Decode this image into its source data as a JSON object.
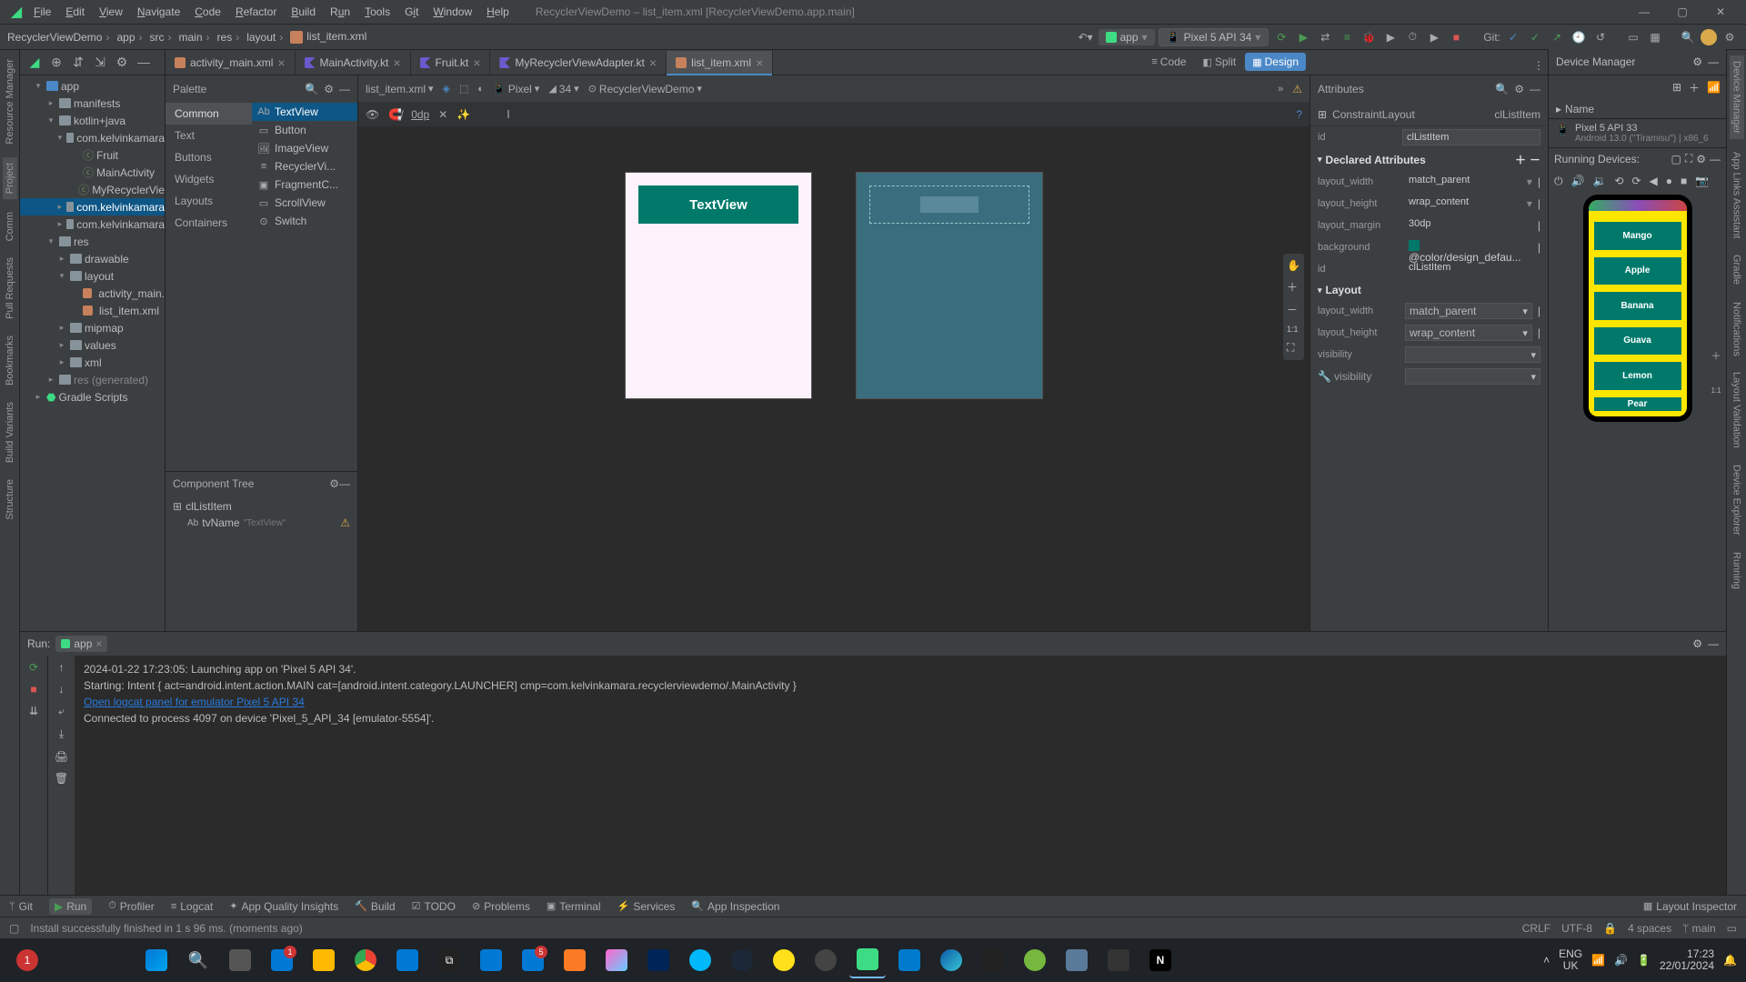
{
  "window": {
    "title": "RecyclerViewDemo – list_item.xml [RecyclerViewDemo.app.main]",
    "menus": [
      "File",
      "Edit",
      "View",
      "Navigate",
      "Code",
      "Refactor",
      "Build",
      "Run",
      "Tools",
      "Git",
      "Window",
      "Help"
    ]
  },
  "breadcrumb": [
    "RecyclerViewDemo",
    "app",
    "src",
    "main",
    "res",
    "layout"
  ],
  "breadcrumb_file": "list_item.xml",
  "run_config": {
    "label": "app"
  },
  "device_select": "Pixel 5 API 34",
  "git_label": "Git:",
  "editor_tabs": [
    {
      "name": "activity_main.xml",
      "kind": "xml",
      "active": false
    },
    {
      "name": "MainActivity.kt",
      "kind": "kt",
      "active": false
    },
    {
      "name": "Fruit.kt",
      "kind": "kt",
      "active": false
    },
    {
      "name": "MyRecyclerViewAdapter.kt",
      "kind": "kt",
      "active": false
    },
    {
      "name": "list_item.xml",
      "kind": "xml",
      "active": true
    }
  ],
  "device_manager": {
    "title": "Device Manager",
    "name_col": "Name",
    "device": {
      "name": "Pixel 5 API 33",
      "sub": "Android 13.0 (\"Tiramisu\") | x86_6"
    },
    "running_label": "Running Devices:"
  },
  "view_modes": {
    "code": "Code",
    "split": "Split",
    "design": "Design"
  },
  "project_tree": {
    "app": "app",
    "manifests": "manifests",
    "kotlinjava": "kotlin+java",
    "pkg1": "com.kelvinkamara",
    "fruit": "Fruit",
    "mainact": "MainActivity",
    "adapter": "MyRecyclerVie",
    "pkg2": "com.kelvinkamara",
    "pkg3": "com.kelvinkamara",
    "res": "res",
    "drawable": "drawable",
    "layout": "layout",
    "act_main": "activity_main.",
    "list_item": "list_item.xml",
    "mipmap": "mipmap",
    "values": "values",
    "xml": "xml",
    "res_gen": "res (generated)",
    "gradle": "Gradle Scripts"
  },
  "palette": {
    "title": "Palette",
    "categories": [
      "Common",
      "Text",
      "Buttons",
      "Widgets",
      "Layouts",
      "Containers"
    ],
    "items": [
      "TextView",
      "Button",
      "ImageView",
      "RecyclerVi...",
      "FragmentC...",
      "ScrollView",
      "Switch"
    ]
  },
  "component_tree": {
    "title": "Component Tree",
    "root": "clListItem",
    "child": "tvName",
    "child_hint": "\"TextView\""
  },
  "design_toolbar": {
    "file": "list_item.xml",
    "device": "Pixel",
    "api": "34",
    "theme": "RecyclerViewDemo",
    "dp": "0dp"
  },
  "canvas": {
    "textview_label": "TextView"
  },
  "attributes": {
    "title": "Attributes",
    "type": "ConstraintLayout",
    "type_id": "clListItem",
    "id_label": "id",
    "id_value": "clListItem",
    "declared": "Declared Attributes",
    "layout": "Layout",
    "rows": {
      "layout_width": {
        "label": "layout_width",
        "value": "match_parent"
      },
      "layout_height": {
        "label": "layout_height",
        "value": "wrap_content"
      },
      "layout_margin": {
        "label": "layout_margin",
        "value": "30dp"
      },
      "background": {
        "label": "background",
        "value": "@color/design_defau..."
      },
      "id2": {
        "label": "id",
        "value": "clListItem"
      },
      "layout_width2": {
        "label": "layout_width",
        "value": "match_parent"
      },
      "layout_height2": {
        "label": "layout_height",
        "value": "wrap_content"
      },
      "visibility": {
        "label": "visibility",
        "value": ""
      },
      "visibility2": {
        "label": "visibility",
        "value": ""
      }
    }
  },
  "emulator": {
    "fruits": [
      "Mango",
      "Apple",
      "Banana",
      "Guava",
      "Lemon",
      "Pear"
    ]
  },
  "run": {
    "tab": "Run:",
    "config": "app",
    "lines": [
      "2024-01-22 17:23:05: Launching app on 'Pixel 5 API 34'.",
      "Starting: Intent { act=android.intent.action.MAIN cat=[android.intent.category.LAUNCHER] cmp=com.kelvinkamara.recyclerviewdemo/.MainActivity }",
      "",
      "Open logcat panel for emulator Pixel 5 API 34",
      "Connected to process 4097 on device 'Pixel_5_API_34 [emulator-5554]'."
    ]
  },
  "bottom_tools": [
    "Git",
    "Run",
    "Profiler",
    "Logcat",
    "App Quality Insights",
    "Build",
    "TODO",
    "Problems",
    "Terminal",
    "Services",
    "App Inspection"
  ],
  "bottom_right": "Layout Inspector",
  "status": {
    "msg": "Install successfully finished in 1 s 96 ms. (moments ago)",
    "enc": "CRLF",
    "charset": "UTF-8",
    "indent": "4 spaces",
    "branch": "main"
  },
  "windows": {
    "lang": "ENG",
    "region": "UK",
    "time": "17:23",
    "date": "22/01/2024"
  },
  "left_tool_labels": {
    "rm": "Resource Manager",
    "proj": "Project",
    "commit": "Comm",
    "pr": "Pull Requests",
    "bv": "Build Variants",
    "struct": "Structure",
    "bm": "Bookmarks"
  },
  "right_tool_labels": {
    "dm": "Device Manager",
    "gradle": "Gradle",
    "notif": "Notifications",
    "lv": "Layout Validation",
    "ala": "App Links Assistant",
    "de": "Device Explorer",
    "running": "Running"
  }
}
